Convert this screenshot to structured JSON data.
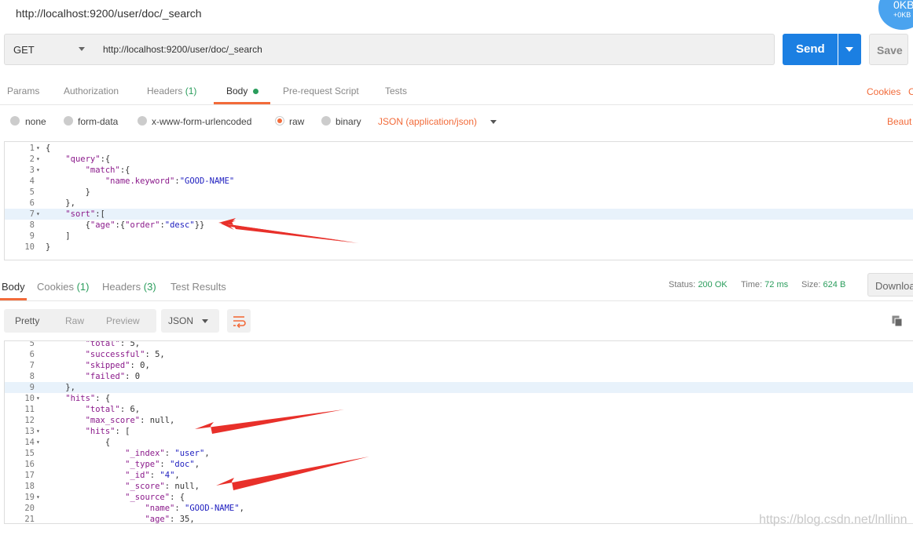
{
  "window": {
    "title": "http://localhost:9200/user/doc/_search",
    "net_main": "0KB",
    "net_sub": "+0KB"
  },
  "request": {
    "method": "GET",
    "url": "http://localhost:9200/user/doc/_search",
    "send_label": "Send",
    "save_label": "Save"
  },
  "request_tabs": {
    "params": "Params",
    "authorization": "Authorization",
    "headers": "Headers",
    "headers_count": "(1)",
    "body": "Body",
    "prerequest": "Pre-request Script",
    "tests": "Tests",
    "cookies": "Cookies",
    "cookies_cut": "C"
  },
  "body_modes": {
    "none": "none",
    "form_data": "form-data",
    "urlencoded": "x-www-form-urlencoded",
    "raw": "raw",
    "binary": "binary",
    "content_type": "JSON (application/json)",
    "beautify": "Beaut"
  },
  "request_body": [
    {
      "n": "1",
      "fold": "▾",
      "text": "{"
    },
    {
      "n": "2",
      "fold": "▾",
      "text": "    \"query\":{"
    },
    {
      "n": "3",
      "fold": "▾",
      "text": "        \"match\":{"
    },
    {
      "n": "4",
      "fold": "",
      "text": "            \"name.keyword\":\"GOOD-NAME\""
    },
    {
      "n": "5",
      "fold": "",
      "text": "        }"
    },
    {
      "n": "6",
      "fold": "",
      "text": "    },"
    },
    {
      "n": "7",
      "fold": "▾",
      "text": "    \"sort\":["
    },
    {
      "n": "8",
      "fold": "",
      "text": "        {\"age\":{\"order\":\"desc\"}}"
    },
    {
      "n": "9",
      "fold": "",
      "text": "    ]"
    },
    {
      "n": "10",
      "fold": "",
      "text": "}"
    }
  ],
  "response_tabs": {
    "body": "Body",
    "cookies": "Cookies",
    "cookies_count": "(1)",
    "headers": "Headers",
    "headers_count": "(3)",
    "test_results": "Test Results"
  },
  "response_status": {
    "status_label": "Status:",
    "status_value": "200 OK",
    "time_label": "Time:",
    "time_value": "72 ms",
    "size_label": "Size:",
    "size_value": "624 B",
    "download": "Downloa"
  },
  "response_view": {
    "pretty": "Pretty",
    "raw": "Raw",
    "preview": "Preview",
    "format": "JSON"
  },
  "response_body": [
    {
      "n": "5",
      "fold": "",
      "text": "        \"total\": 5,"
    },
    {
      "n": "6",
      "fold": "",
      "text": "        \"successful\": 5,"
    },
    {
      "n": "7",
      "fold": "",
      "text": "        \"skipped\": 0,"
    },
    {
      "n": "8",
      "fold": "",
      "text": "        \"failed\": 0"
    },
    {
      "n": "9",
      "fold": "",
      "text": "    },"
    },
    {
      "n": "10",
      "fold": "▾",
      "text": "    \"hits\": {"
    },
    {
      "n": "11",
      "fold": "",
      "text": "        \"total\": 6,"
    },
    {
      "n": "12",
      "fold": "",
      "text": "        \"max_score\": null,"
    },
    {
      "n": "13",
      "fold": "▾",
      "text": "        \"hits\": ["
    },
    {
      "n": "14",
      "fold": "▾",
      "text": "            {"
    },
    {
      "n": "15",
      "fold": "",
      "text": "                \"_index\": \"user\","
    },
    {
      "n": "16",
      "fold": "",
      "text": "                \"_type\": \"doc\","
    },
    {
      "n": "17",
      "fold": "",
      "text": "                \"_id\": \"4\","
    },
    {
      "n": "18",
      "fold": "",
      "text": "                \"_score\": null,"
    },
    {
      "n": "19",
      "fold": "▾",
      "text": "                \"_source\": {"
    },
    {
      "n": "20",
      "fold": "",
      "text": "                    \"name\": \"GOOD-NAME\","
    },
    {
      "n": "21",
      "fold": "",
      "text": "                    \"age\": 35,"
    }
  ],
  "watermark": "https://blog.csdn.net/lnllinn",
  "colors": {
    "accent": "#f26b3a",
    "send": "#1b7fe2",
    "success": "#2a9d5c",
    "annotation_arrow": "#e8302a"
  }
}
